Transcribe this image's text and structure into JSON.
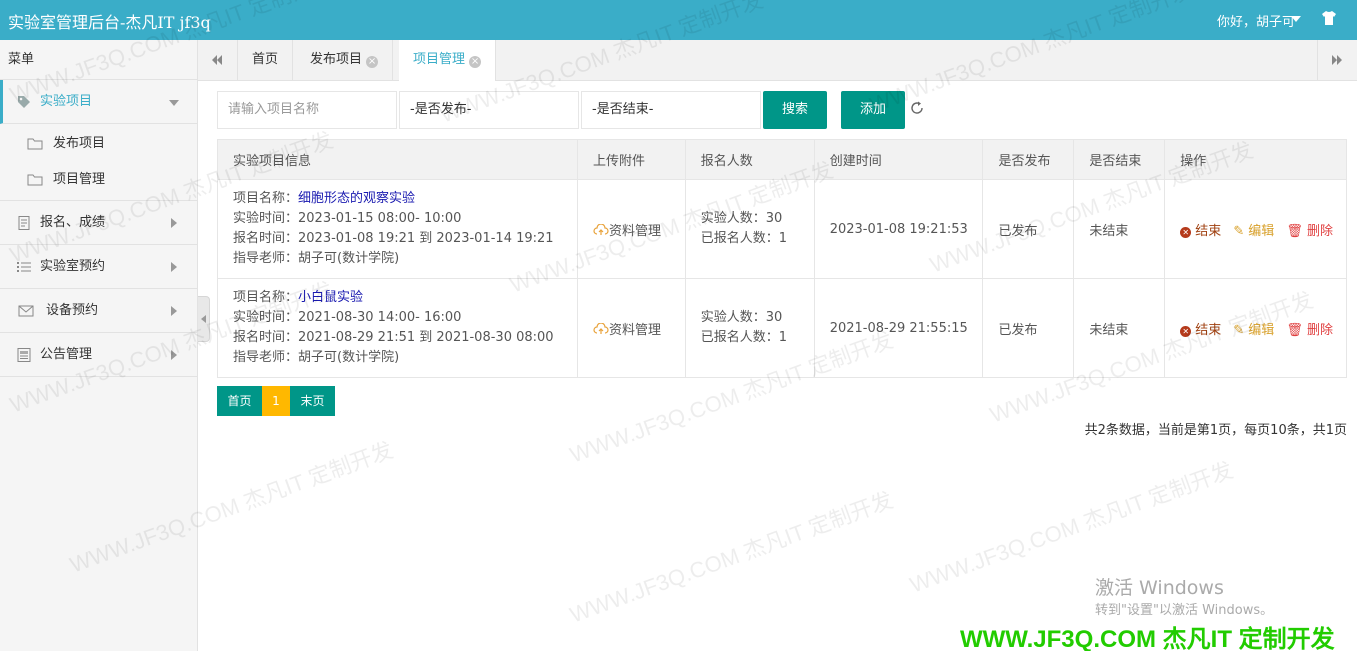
{
  "app_title": "实验室管理后台-杰凡IT jf3q",
  "user_greeting": "你好，胡子可",
  "sidebar": {
    "menu_header": "菜单",
    "items": [
      {
        "label": "实验项目",
        "icon": "tag-icon",
        "active": true
      },
      {
        "label": "报名、成绩",
        "icon": "document-icon"
      },
      {
        "label": "实验室预约",
        "icon": "list-icon"
      },
      {
        "label": "设备预约",
        "icon": "envelope-icon"
      },
      {
        "label": "公告管理",
        "icon": "notice-icon"
      }
    ],
    "subitems": [
      {
        "label": "发布项目"
      },
      {
        "label": "项目管理"
      }
    ]
  },
  "tabs": [
    {
      "label": "首页"
    },
    {
      "label": "发布项目"
    },
    {
      "label": "项目管理",
      "active": true
    }
  ],
  "search": {
    "name_placeholder": "请输入项目名称",
    "publish_select": "-是否发布-",
    "end_select": "-是否结束-",
    "search_label": "搜索",
    "add_label": "添加"
  },
  "table": {
    "headers": [
      "实验项目信息",
      "上传附件",
      "报名人数",
      "创建时间",
      "是否发布",
      "是否结束",
      "操作"
    ],
    "rows": [
      {
        "name_label": "项目名称：",
        "name": "细胞形态的观察实验",
        "time": "实验时间：2023-01-15 08:00- 10:00",
        "signup": "报名时间：2023-01-08 19:21 到 2023-01-14 19:21",
        "teacher": "指导老师：胡子可(数计学院)",
        "attachment": "资料管理",
        "capacity": "实验人数：30",
        "enrolled": "已报名人数：1",
        "created": "2023-01-08 19:21:53",
        "published": "已发布",
        "ended": "未结束",
        "op_end": "结束",
        "op_edit": "编辑",
        "op_delete": "删除"
      },
      {
        "name_label": "项目名称：",
        "name": "小白鼠实验",
        "time": "实验时间：2021-08-30 14:00- 16:00",
        "signup": "报名时间：2021-08-29 21:51 到 2021-08-30 08:00",
        "teacher": "指导老师：胡子可(数计学院)",
        "attachment": "资料管理",
        "capacity": "实验人数：30",
        "enrolled": "已报名人数：1",
        "created": "2021-08-29 21:55:15",
        "published": "已发布",
        "ended": "未结束",
        "op_end": "结束",
        "op_edit": "编辑",
        "op_delete": "删除"
      }
    ]
  },
  "pager": {
    "first": "首页",
    "current": "1",
    "last": "末页",
    "info": "共2条数据，当前是第1页，每页10条，共1页"
  },
  "overlay": {
    "windows_activate": "激活 Windows",
    "windows_activate_sub": "转到\"设置\"以激活 Windows。",
    "brand": "WWW.JF3Q.COM 杰凡IT   定制开发",
    "watermark": "WWW.JF3Q.COM 杰凡IT  定制开发"
  },
  "colors": {
    "topbar": "#3aadc8",
    "primary_button": "#009688",
    "pager_current": "#ffb800"
  }
}
